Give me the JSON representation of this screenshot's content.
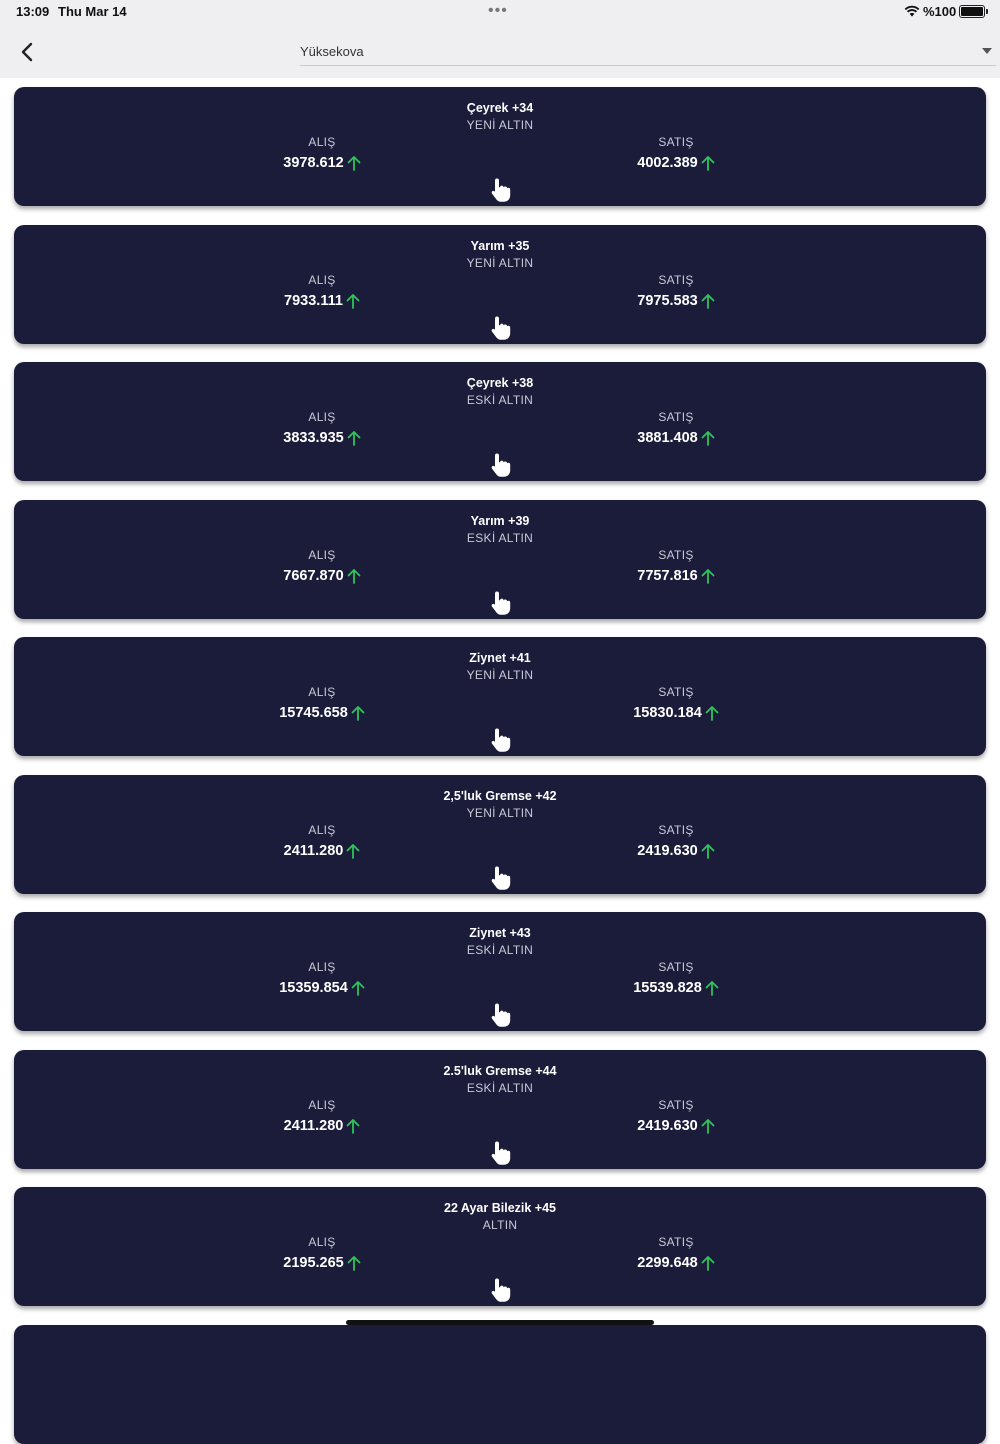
{
  "status_bar": {
    "time": "13:09",
    "date": "Thu Mar 14",
    "dots": "•••",
    "battery": "%100"
  },
  "header": {
    "location_picker_value": "Yüksekova"
  },
  "labels": {
    "buy": "ALIŞ",
    "sell": "SATIŞ"
  },
  "colors": {
    "card_bg": "#1b1c3a",
    "up_arrow": "#2ec45a"
  },
  "products": [
    {
      "title": "Çeyrek +34",
      "subtitle": "YENİ ALTIN",
      "buy": "3978.612",
      "sell": "4002.389",
      "buy_trend": "up",
      "sell_trend": "up"
    },
    {
      "title": "Yarım +35",
      "subtitle": "YENİ ALTIN",
      "buy": "7933.111",
      "sell": "7975.583",
      "buy_trend": "up",
      "sell_trend": "up"
    },
    {
      "title": "Çeyrek +38",
      "subtitle": "ESKİ ALTIN",
      "buy": "3833.935",
      "sell": "3881.408",
      "buy_trend": "up",
      "sell_trend": "up"
    },
    {
      "title": "Yarım +39",
      "subtitle": "ESKİ ALTIN",
      "buy": "7667.870",
      "sell": "7757.816",
      "buy_trend": "up",
      "sell_trend": "up"
    },
    {
      "title": "Ziynet +41",
      "subtitle": "YENİ ALTIN",
      "buy": "15745.658",
      "sell": "15830.184",
      "buy_trend": "up",
      "sell_trend": "up"
    },
    {
      "title": "2,5'luk Gremse +42",
      "subtitle": "YENİ ALTIN",
      "buy": "2411.280",
      "sell": "2419.630",
      "buy_trend": "up",
      "sell_trend": "up"
    },
    {
      "title": "Ziynet +43",
      "subtitle": "ESKİ ALTIN",
      "buy": "15359.854",
      "sell": "15539.828",
      "buy_trend": "up",
      "sell_trend": "up"
    },
    {
      "title": "2.5'luk Gremse +44",
      "subtitle": "ESKİ ALTIN",
      "buy": "2411.280",
      "sell": "2419.630",
      "buy_trend": "up",
      "sell_trend": "up"
    },
    {
      "title": "22 Ayar Bilezik +45",
      "subtitle": "ALTIN",
      "buy": "2195.265",
      "sell": "2299.648",
      "buy_trend": "up",
      "sell_trend": "up"
    }
  ]
}
